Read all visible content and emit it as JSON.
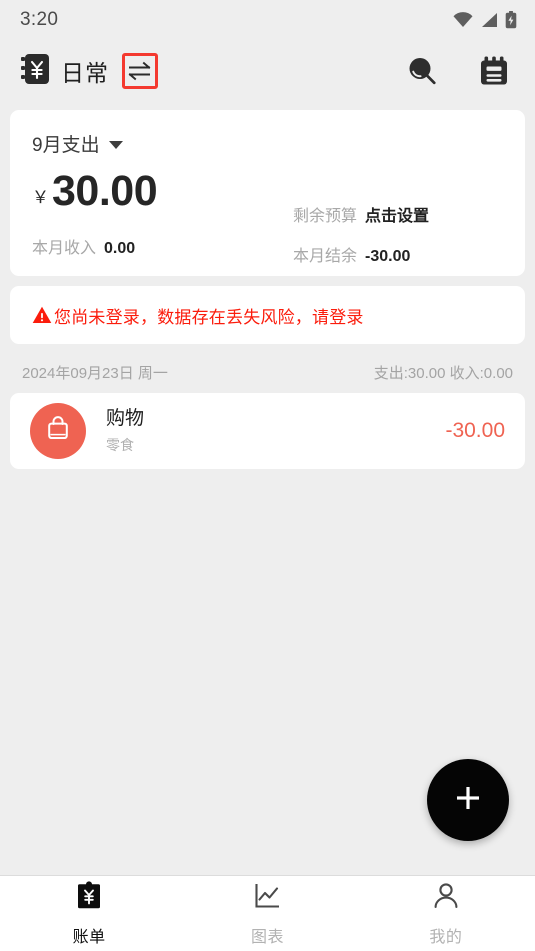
{
  "status_bar": {
    "time": "3:20",
    "icons": [
      "wifi-icon",
      "signal-icon",
      "battery-charging-icon"
    ]
  },
  "app_bar": {
    "ledger_icon": "ledger-yen-icon",
    "title": "日常",
    "swap_icon": "swap-arrows-icon",
    "swap_highlight_color": "#f4392f",
    "search_icon": "search-icon",
    "calendar_icon": "calendar-note-icon"
  },
  "summary": {
    "month_label": "9月支出",
    "dropdown_icon": "chevron-down-icon",
    "currency_symbol": "￥",
    "amount": "30.00",
    "budget_label": "剩余预算",
    "budget_value": "点击设置",
    "balance_label": "本月结余",
    "balance_value": "-30.00",
    "income_label": "本月收入",
    "income_value": "0.00"
  },
  "warning": {
    "icon": "warning-triangle-icon",
    "text": "您尚未登录，数据存在丢失风险，请登录",
    "color": "#fb1c0c"
  },
  "day_group": {
    "date": "2024年09月23日 周一",
    "totals": "支出:30.00  收入:0.00"
  },
  "transactions": [
    {
      "icon": "shopping-bag-icon",
      "icon_bg": "#ef6352",
      "title": "购物",
      "subtitle": "零食",
      "amount": "-30.00",
      "amount_color": "#ef6352"
    }
  ],
  "fab": {
    "icon": "plus-icon",
    "background": "#050505"
  },
  "bottom_nav": {
    "items": [
      {
        "icon": "bill-clipboard-icon",
        "label": "账单",
        "active": true
      },
      {
        "icon": "chart-line-icon",
        "label": "图表",
        "active": false
      },
      {
        "icon": "person-icon",
        "label": "我的",
        "active": false
      }
    ]
  }
}
